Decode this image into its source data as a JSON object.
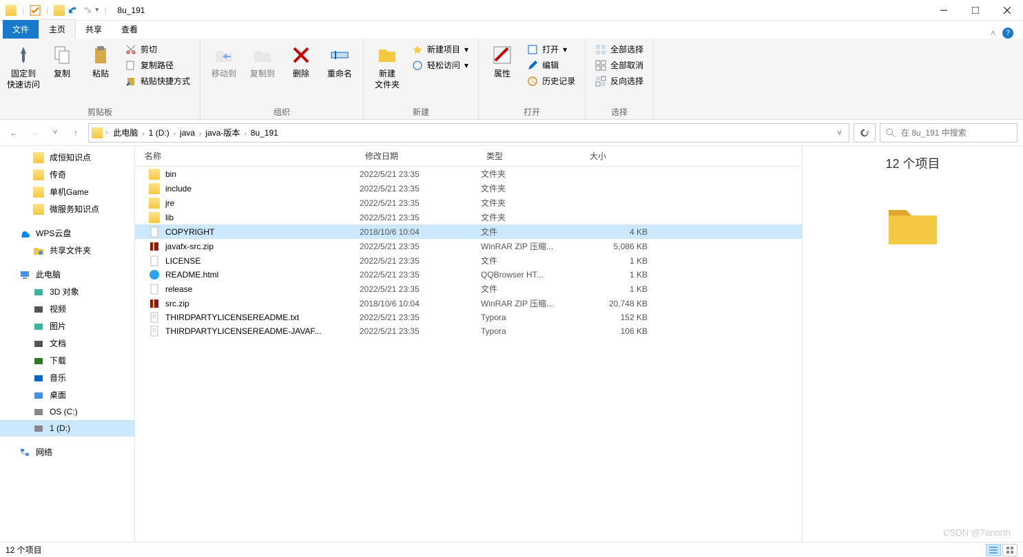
{
  "title": "8u_191",
  "tabs": {
    "file": "文件",
    "home": "主页",
    "share": "共享",
    "view": "查看"
  },
  "ribbon": {
    "clipboard": {
      "label": "剪贴板",
      "pin": "固定到\n快速访问",
      "copy": "复制",
      "paste": "粘贴",
      "cut": "剪切",
      "copypath": "复制路径",
      "shortcut": "粘贴快捷方式"
    },
    "organize": {
      "label": "组织",
      "moveto": "移动到",
      "copyto": "复制到",
      "delete": "删除",
      "rename": "重命名"
    },
    "new": {
      "label": "新建",
      "folder": "新建\n文件夹",
      "newitem": "新建项目",
      "easy": "轻松访问"
    },
    "open": {
      "label": "打开",
      "props": "属性",
      "open": "打开",
      "edit": "编辑",
      "history": "历史记录"
    },
    "select": {
      "label": "选择",
      "all": "全部选择",
      "none": "全部取消",
      "invert": "反向选择"
    }
  },
  "breadcrumb": [
    "此电脑",
    "1 (D:)",
    "java",
    "java-版本",
    "8u_191"
  ],
  "search_placeholder": "在 8u_191 中搜索",
  "columns": {
    "name": "名称",
    "date": "修改日期",
    "type": "类型",
    "size": "大小"
  },
  "nav": {
    "quick": [
      "成恒知识点",
      "传奇",
      "单机Game",
      "微服务知识点"
    ],
    "wps": "WPS云盘",
    "wps_sub": "共享文件夹",
    "pc": "此电脑",
    "pc_items": [
      "3D 对象",
      "视频",
      "图片",
      "文档",
      "下载",
      "音乐",
      "桌面",
      "OS (C:)",
      "1 (D:)"
    ],
    "net": "网络"
  },
  "files": [
    {
      "icon": "folder",
      "name": "bin",
      "date": "2022/5/21 23:35",
      "type": "文件夹",
      "size": ""
    },
    {
      "icon": "folder",
      "name": "include",
      "date": "2022/5/21 23:35",
      "type": "文件夹",
      "size": ""
    },
    {
      "icon": "folder",
      "name": "jre",
      "date": "2022/5/21 23:35",
      "type": "文件夹",
      "size": ""
    },
    {
      "icon": "folder",
      "name": "lib",
      "date": "2022/5/21 23:35",
      "type": "文件夹",
      "size": ""
    },
    {
      "icon": "file",
      "name": "COPYRIGHT",
      "date": "2018/10/6 10:04",
      "type": "文件",
      "size": "4 KB",
      "selected": true
    },
    {
      "icon": "zip",
      "name": "javafx-src.zip",
      "date": "2022/5/21 23:35",
      "type": "WinRAR ZIP 压缩...",
      "size": "5,086 KB"
    },
    {
      "icon": "file",
      "name": "LICENSE",
      "date": "2022/5/21 23:35",
      "type": "文件",
      "size": "1 KB"
    },
    {
      "icon": "html",
      "name": "README.html",
      "date": "2022/5/21 23:35",
      "type": "QQBrowser HT...",
      "size": "1 KB"
    },
    {
      "icon": "file",
      "name": "release",
      "date": "2022/5/21 23:35",
      "type": "文件",
      "size": "1 KB"
    },
    {
      "icon": "zip",
      "name": "src.zip",
      "date": "2018/10/6 10:04",
      "type": "WinRAR ZIP 压缩...",
      "size": "20,748 KB"
    },
    {
      "icon": "txt",
      "name": "THIRDPARTYLICENSEREADME.txt",
      "date": "2022/5/21 23:35",
      "type": "Typora",
      "size": "152 KB"
    },
    {
      "icon": "txt",
      "name": "THIRDPARTYLICENSEREADME-JAVAF...",
      "date": "2022/5/21 23:35",
      "type": "Typora",
      "size": "106 KB"
    }
  ],
  "preview_title": "12 个项目",
  "status_text": "12 个项目",
  "watermark": "CSDN @7anorth"
}
